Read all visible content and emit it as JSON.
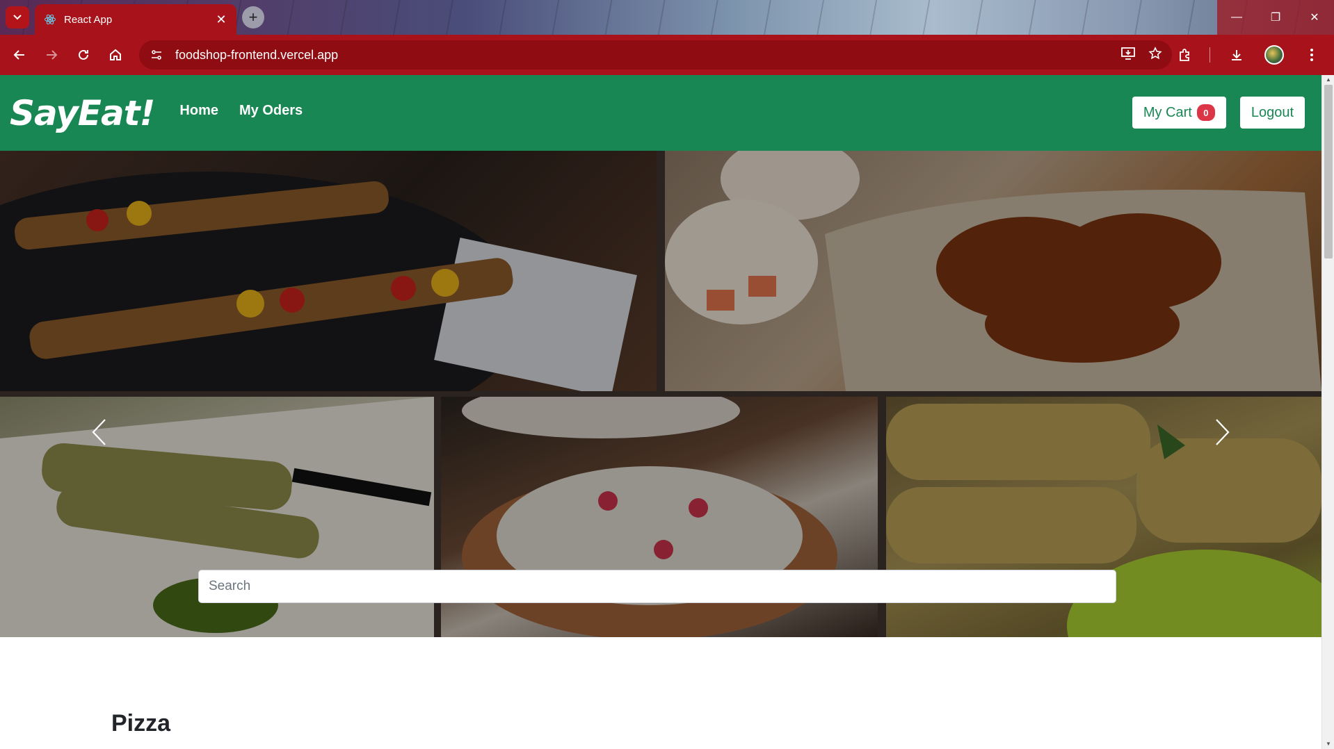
{
  "browser": {
    "tab_title": "React App",
    "url": "foodshop-frontend.vercel.app"
  },
  "navbar": {
    "brand": "SayEat!",
    "links": [
      "Home",
      "My Oders"
    ],
    "cart_label": "My Cart",
    "cart_count": "0",
    "logout_label": "Logout"
  },
  "hero": {
    "search_placeholder": "Search"
  },
  "sections": {
    "first_category": "Pizza"
  },
  "colors": {
    "browser_theme": "#a8121a",
    "navbar_bg": "#198754",
    "badge": "#dc3545"
  }
}
